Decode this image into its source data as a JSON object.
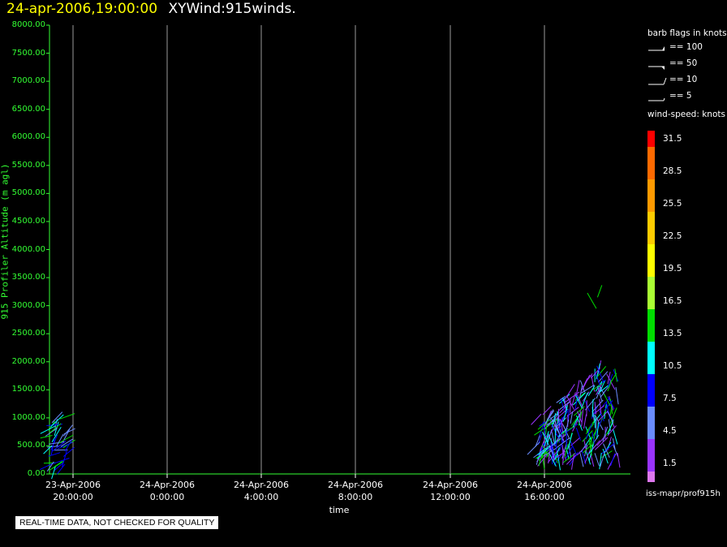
{
  "header": {
    "timestamp": "24-apr-2006,19:00:00",
    "product": "XYWind:915winds."
  },
  "chart_data": {
    "type": "scatter",
    "ylabel": "915 Profiler Altitude (m agl)",
    "xlabel": "time",
    "ylim": [
      0,
      8000
    ],
    "yticks": [
      "0.00",
      "500.00",
      "1000.00",
      "1500.00",
      "2000.00",
      "2500.00",
      "3000.00",
      "3500.00",
      "4000.00",
      "4500.00",
      "5000.00",
      "5500.00",
      "6000.00",
      "6500.00",
      "7000.00",
      "7500.00",
      "8000.00"
    ],
    "xticks": [
      {
        "date": "23-Apr-2006",
        "time": "20:00:00"
      },
      {
        "date": "24-Apr-2006",
        "time": "0:00:00"
      },
      {
        "date": "24-Apr-2006",
        "time": "4:00:00"
      },
      {
        "date": "24-Apr-2006",
        "time": "8:00:00"
      },
      {
        "date": "24-Apr-2006",
        "time": "12:00:00"
      },
      {
        "date": "24-Apr-2006",
        "time": "16:00:00"
      }
    ],
    "grid": "vertical lines at x ticks",
    "series_note": "wind barbs, colored by wind speed; early cluster near 20:00 23-Apr (≈150–1150 m), dense cluster 16:00–19:00 24-Apr (≈300–2100 m), isolated barbs near 2900–3200 m"
  },
  "barb_legend": {
    "title": "barb flags in knots",
    "items": [
      "== 100",
      "== 50",
      "== 10",
      "== 5"
    ]
  },
  "colorbar": {
    "title": "wind-speed: knots",
    "labels": [
      "31.5",
      "28.5",
      "25.5",
      "22.5",
      "19.5",
      "16.5",
      "13.5",
      "10.5",
      "7.5",
      "4.5",
      "1.5"
    ],
    "colors": [
      "#ff0000",
      "#ff6a00",
      "#ff9a00",
      "#ffcc00",
      "#ffff00",
      "#aaff33",
      "#00dd00",
      "#00ffff",
      "#0000ff",
      "#6a8cff",
      "#9933ff",
      "#dd77ee"
    ]
  },
  "footer": {
    "path": "iss-mapr/prof915h"
  },
  "notice": "REAL-TIME DATA, NOT CHECKED FOR QUALITY"
}
